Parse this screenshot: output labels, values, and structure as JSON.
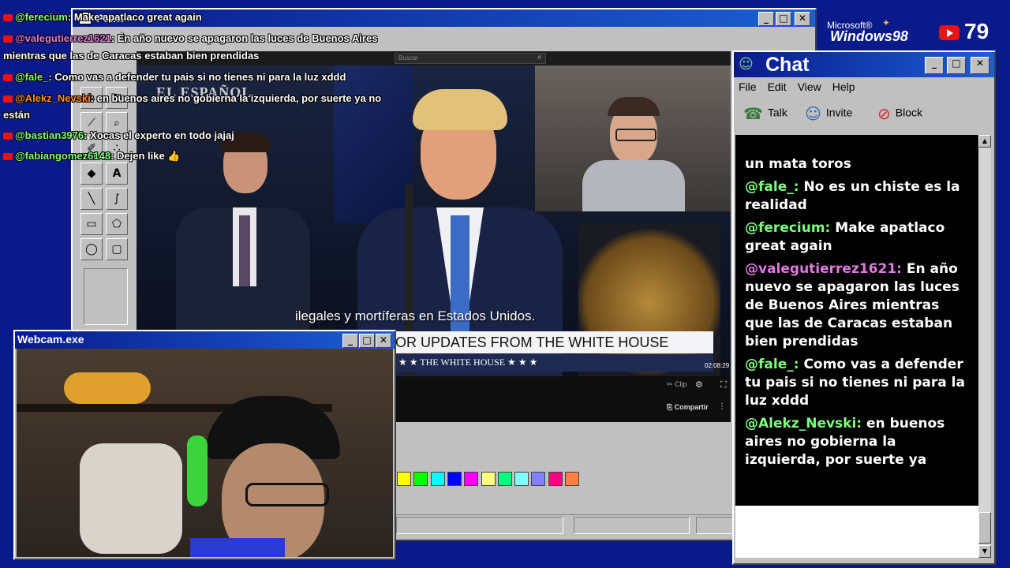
{
  "overlay_chat": [
    {
      "user": "@ferecium",
      "text": ": Make apatlaco great again",
      "color": "#7dff7d"
    },
    {
      "user": "@valegutierrez1621",
      "text": ": En año nuevo se apagaron las luces de Buenos Aires",
      "color": "#e07ae0"
    },
    {
      "user": "",
      "text": "mientras que las de Caracas estaban bien prendidas",
      "color": "#ffffff"
    },
    {
      "user": "@fale_",
      "text": ": Como vas a defender tu pais si no tienes ni para la luz xddd",
      "color": "#7dff7d"
    },
    {
      "user": "@Alekz_Nevski",
      "text": ": en buenos aires no gobierna la izquierda, por suerte ya no",
      "color": "#ff8c2a"
    },
    {
      "user": "",
      "text": "están",
      "color": "#ffffff"
    },
    {
      "user": "@bastian3976",
      "text": ": Xocas el experto en todo jajaj",
      "color": "#7dff7d"
    },
    {
      "user": "@fabiangomez6148",
      "text": ": Dejen like 👍",
      "color": "#7dff7d"
    }
  ],
  "paint": {
    "title": "Paint",
    "menu_partial": "it",
    "colors": [
      "#ffff00",
      "#00ff00",
      "#00ffff",
      "#0000ff",
      "#ff00ff",
      "#ffff80",
      "#00ff80",
      "#80ffff",
      "#8080ff",
      "#ff0080",
      "#ff8040"
    ]
  },
  "video": {
    "subtitle": "ilegales y mortíferas en Estados Unidos.",
    "banner": "OR UPDATES FROM THE WHITE HOUSE",
    "banner_sub": "★ ★ THE WHITE HOUSE ★ ★ ★",
    "logo": "EL ESPAÑOL",
    "time": "02:08:29",
    "clip": "Clip",
    "share": "Compartir",
    "search": "Buscar"
  },
  "brand": {
    "windows": "Windows98",
    "microsoft": "Microsoft®",
    "viewers": "79"
  },
  "webcam": {
    "title": "Webcam.exe"
  },
  "chat_window": {
    "title": "Chat",
    "menu": [
      "File",
      "Edit",
      "View",
      "Help"
    ],
    "toolbar": [
      "Talk",
      "Invite",
      "Block"
    ],
    "messages": [
      {
        "user": "",
        "text": "un mata toros",
        "color": "#7dff7d"
      },
      {
        "user": "@fale_:",
        "text": " No es un chiste es la realidad",
        "color": "#7dff7d"
      },
      {
        "user": "@ferecium:",
        "text": " Make apatlaco great again",
        "color": "#7dff7d"
      },
      {
        "user": "@valegutierrez1621:",
        "text": " En año nuevo se apagaron las luces de Buenos Aires mientras que las de Caracas estaban bien prendidas",
        "color": "#e07ae0"
      },
      {
        "user": "@fale_:",
        "text": " Como vas a defender tu pais si no tienes ni para la luz xddd",
        "color": "#7dff7d"
      },
      {
        "user": "@Alekz_Nevski:",
        "text": " en buenos aires no gobierna la izquierda, por suerte ya",
        "color": "#7dff7d"
      }
    ]
  }
}
